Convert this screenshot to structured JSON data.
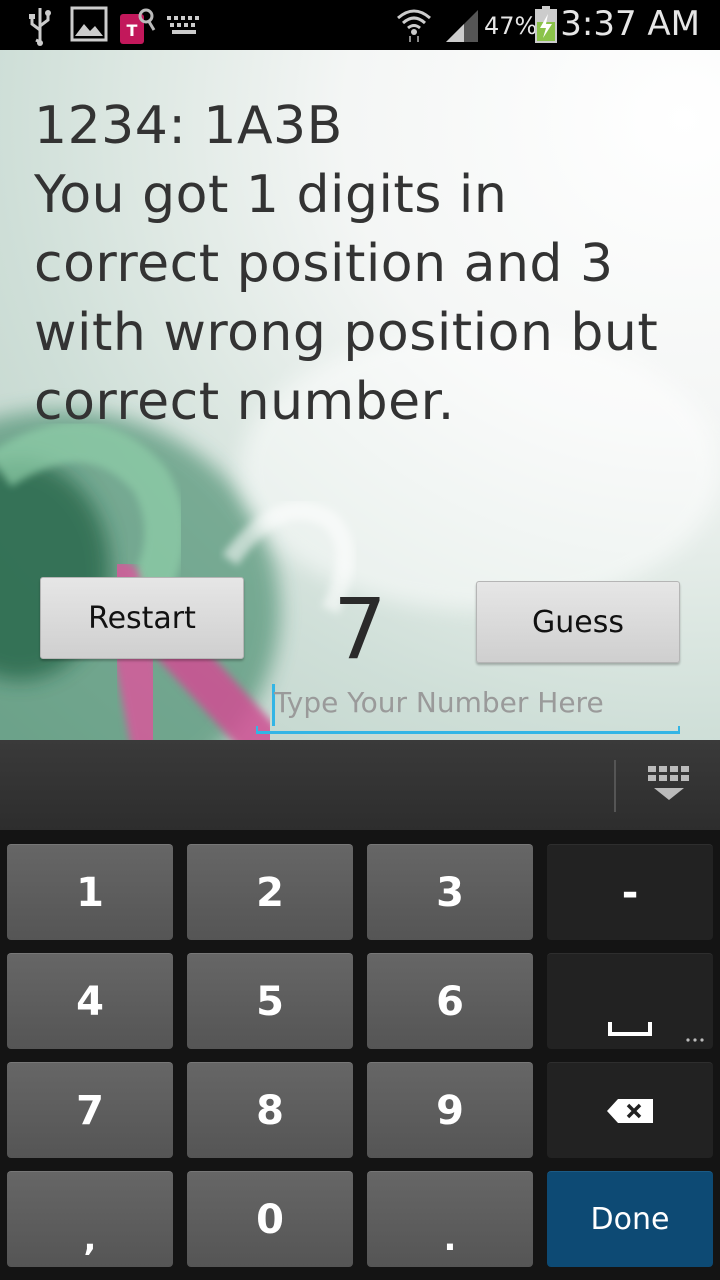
{
  "status_bar": {
    "battery_percent": "47%",
    "time": "3:37 AM",
    "icons": [
      "usb-icon",
      "gallery-icon",
      "tmobile-icon",
      "keyboard-icon",
      "wifi-icon",
      "signal-icon",
      "battery-charging-icon"
    ]
  },
  "game": {
    "result_text": "1234: 1A3B\nYou got 1 digits in correct position and 3 with wrong position but correct number.",
    "restart_label": "Restart",
    "guess_label": "Guess",
    "attempt_count": "7",
    "input_value": "",
    "input_placeholder": "Type Your Number Here"
  },
  "keyboard": {
    "rows": [
      [
        "1",
        "2",
        "3",
        "-"
      ],
      [
        "4",
        "5",
        "6",
        "space"
      ],
      [
        "7",
        "8",
        "9",
        "backspace"
      ],
      [
        ",",
        "0",
        ".",
        "Done"
      ]
    ],
    "done_label": "Done",
    "dash_label": "-",
    "comma_label": ",",
    "period_label": ".",
    "accent_color": "#33b5e5",
    "done_color": "#0d4a74"
  }
}
